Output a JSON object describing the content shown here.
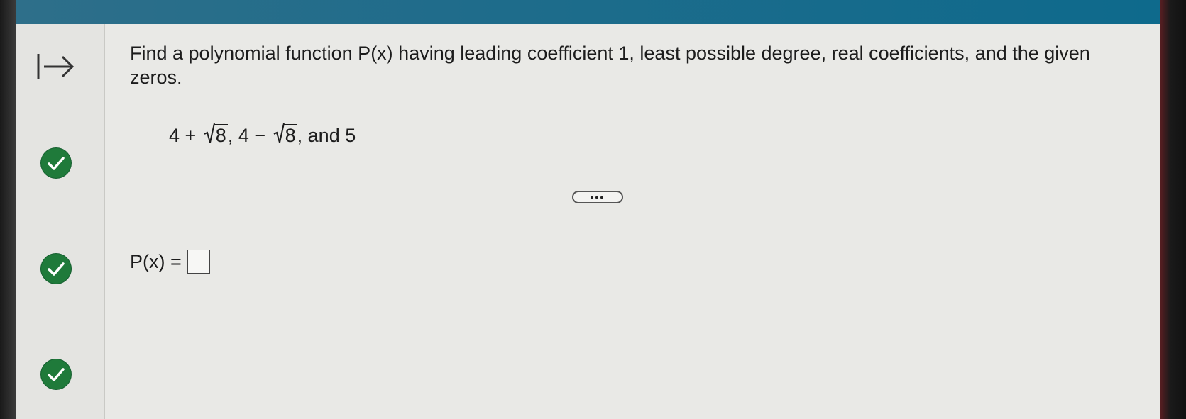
{
  "question": {
    "text": "Find a polynomial function P(x) having leading coefficient 1, least possible degree, real coefficients, and the given zeros."
  },
  "zeros": {
    "z1_prefix": "4 + ",
    "z1_radicand": "8",
    "z2_prefix": ", 4 − ",
    "z2_radicand": "8",
    "suffix": ", and 5"
  },
  "more_button": {
    "label": "•••"
  },
  "answer": {
    "label": "P(x) =",
    "value": ""
  },
  "sidebar": {
    "icons": [
      "arrow-to-right-icon",
      "checkmark-icon",
      "checkmark-icon",
      "checkmark-icon"
    ]
  },
  "colors": {
    "topbar": "#1f6c8b",
    "check": "#1f7a3a",
    "panel": "#e9e9e6"
  }
}
